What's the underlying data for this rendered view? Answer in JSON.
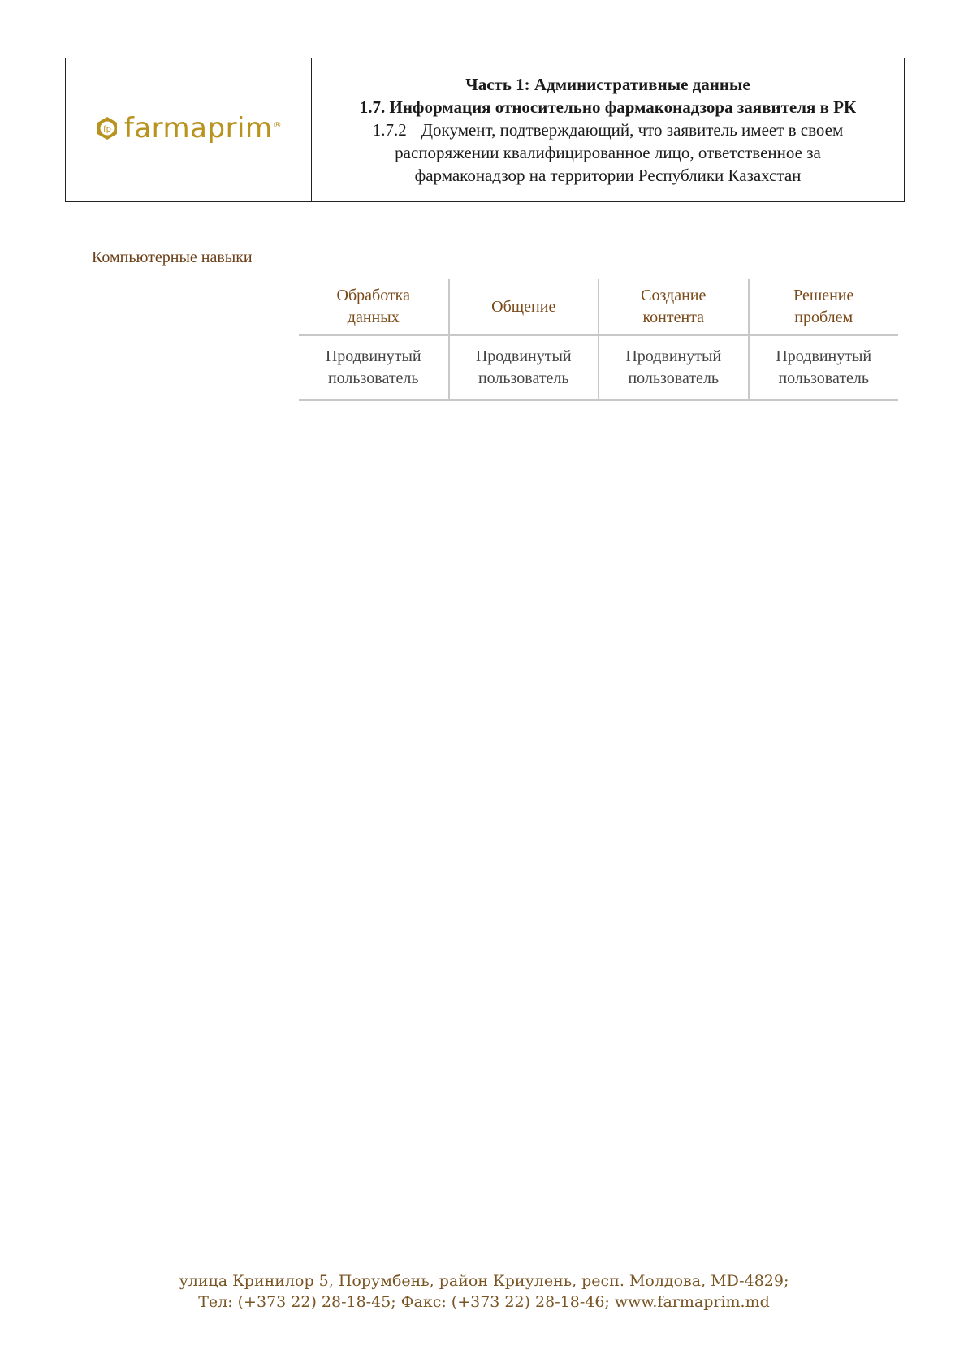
{
  "header": {
    "logo_text": "farmaprim",
    "logo_mark_text": "fp",
    "logo_reg": "®",
    "part_title": "Часть 1: Административные данные",
    "section_title": "1.7. Информация относительно фармаконадзора заявителя в РК",
    "doc_number": "1.7.2",
    "doc_title_line1": "Документ, подтверждающий, что заявитель имеет в своем",
    "doc_title_line2": "распоряжении квалифицированное лицо, ответственное за",
    "doc_title_line3": "фармаконадзор на территории Республики Казахстан"
  },
  "skills": {
    "label": "Компьютерные навыки",
    "columns": [
      {
        "header_line1": "Обработка",
        "header_line2": "данных",
        "value_line1": "Продвинутый",
        "value_line2": "пользователь"
      },
      {
        "header_line1": "Общение",
        "header_line2": "",
        "value_line1": "Продвинутый",
        "value_line2": "пользователь"
      },
      {
        "header_line1": "Создание",
        "header_line2": "контента",
        "value_line1": "Продвинутый",
        "value_line2": "пользователь"
      },
      {
        "header_line1": "Решение",
        "header_line2": "проблем",
        "value_line1": "Продвинутый",
        "value_line2": "пользователь"
      }
    ]
  },
  "footer": {
    "line1": "улица Кринилор 5, Порумбень, район Криулень, респ. Молдова, MD-4829;",
    "line2": "Тел: (+373 22) 28-18-45; Факс: (+373 22) 28-18-46; www.farmaprim.md"
  },
  "colors": {
    "logo_gold": "#b8931f",
    "accent_brown": "#7a4a1a",
    "footer_brown": "#7a5524"
  }
}
